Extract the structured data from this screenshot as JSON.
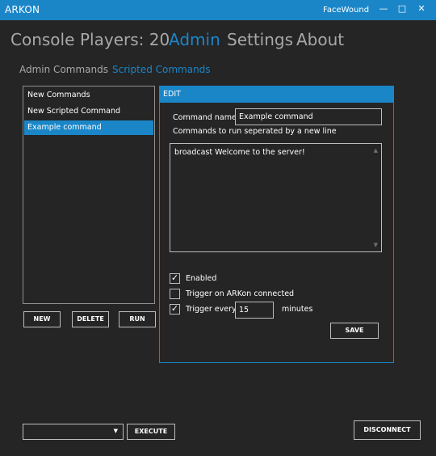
{
  "window": {
    "title": "ARKON",
    "user": "FaceWound",
    "minimize_glyph": "—",
    "maximize_glyph": "□",
    "close_glyph": "✕"
  },
  "nav": {
    "console": "Console",
    "players": "Players: 20",
    "admin": "Admin",
    "settings": "Settings",
    "about": "About"
  },
  "subtabs": {
    "admin_commands": "Admin Commands",
    "scripted_commands": "Scripted Commands"
  },
  "command_list": {
    "items": [
      "New Commands",
      "New Scripted Command",
      "Example command"
    ],
    "selected_index": 2
  },
  "list_buttons": {
    "new": "NEW",
    "delete": "DELETE",
    "run": "RUN"
  },
  "edit": {
    "header": "EDIT",
    "name_label": "Command name",
    "name_value": "Example command",
    "commands_label": "Commands to run seperated by a new line",
    "commands_text": "broadcast Welcome to the server!",
    "enabled_label": "Enabled",
    "enabled_checked": true,
    "trigger_connected_label": "Trigger on ARKon connected",
    "trigger_connected_checked": false,
    "trigger_every_label": "Trigger every",
    "trigger_every_checked": true,
    "trigger_every_value": "15",
    "minutes_label": "minutes",
    "save": "SAVE"
  },
  "footer": {
    "dropdown_value": "",
    "execute": "EXECUTE",
    "disconnect": "DISCONNECT"
  },
  "colors": {
    "accent": "#1a86c8",
    "background": "#252526",
    "muted_text": "#a8a8a8"
  }
}
